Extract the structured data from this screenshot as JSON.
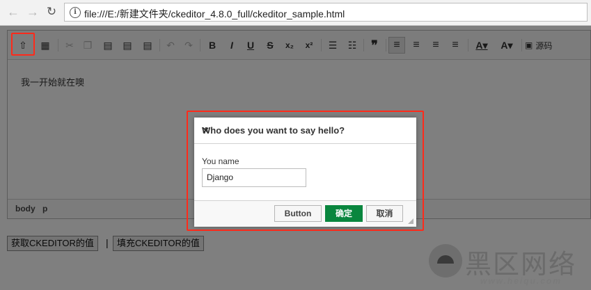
{
  "browser": {
    "back_icon": "←",
    "forward_icon": "→",
    "reload_icon": "↻",
    "info_icon": "i",
    "url": "file:///E:/新建文件夹/ckeditor_4.8.0_full/ckeditor_sample.html"
  },
  "toolbar": {
    "buttons": [
      {
        "name": "say-hello",
        "glyph": "⇧"
      },
      {
        "name": "table",
        "glyph": "▦"
      },
      {
        "name": "cut",
        "glyph": "✂"
      },
      {
        "name": "copy",
        "glyph": "❐"
      },
      {
        "name": "paste",
        "glyph": "▤"
      },
      {
        "name": "paste-text",
        "glyph": "▤"
      },
      {
        "name": "paste-word",
        "glyph": "▤"
      },
      {
        "name": "undo",
        "glyph": "↶"
      },
      {
        "name": "redo",
        "glyph": "↷"
      },
      {
        "name": "bold",
        "glyph": "B"
      },
      {
        "name": "italic",
        "glyph": "I"
      },
      {
        "name": "underline",
        "glyph": "U"
      },
      {
        "name": "strike",
        "glyph": "S"
      },
      {
        "name": "subscript",
        "glyph": "x₂"
      },
      {
        "name": "superscript",
        "glyph": "x²"
      },
      {
        "name": "numbered-list",
        "glyph": "☰"
      },
      {
        "name": "bulleted-list",
        "glyph": "☷"
      },
      {
        "name": "blockquote",
        "glyph": "❞"
      },
      {
        "name": "align-left",
        "glyph": "≡"
      },
      {
        "name": "align-center",
        "glyph": "≡"
      },
      {
        "name": "align-right",
        "glyph": "≡"
      },
      {
        "name": "align-justify",
        "glyph": "≡"
      },
      {
        "name": "text-color",
        "glyph": "A▾"
      },
      {
        "name": "bg-color",
        "glyph": "A▾"
      }
    ],
    "source_label": "源码",
    "source_icon": "▣"
  },
  "editor": {
    "content": "我一开始就在噢",
    "path": [
      "body",
      "p"
    ]
  },
  "page_buttons": {
    "get_label": "获取CKEDITOR的值",
    "separator": "|",
    "fill_label": "填充CKEDITOR的值"
  },
  "dialog": {
    "title": "Who does you want to say hello?",
    "close_icon": "✕",
    "field_label": "You name",
    "field_value": "Django",
    "button_label": "Button",
    "ok_label": "确定",
    "cancel_label": "取消"
  },
  "watermark": {
    "text": "黑区网络",
    "url": "www.heiqu.com"
  },
  "colors": {
    "highlight": "#ff2a1a",
    "ok_button": "#09863e"
  }
}
